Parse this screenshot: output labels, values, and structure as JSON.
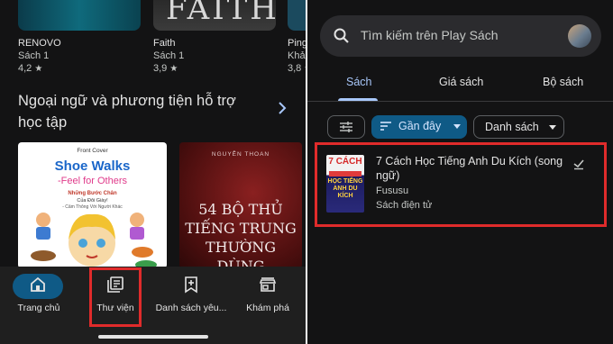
{
  "left": {
    "top_books": [
      {
        "title": "RENOVO",
        "subtitle": "Sách 1",
        "rating": "4,2"
      },
      {
        "title": "Faith",
        "subtitle": "Sách 1",
        "rating": "3,9",
        "cover_text": "FAITH"
      },
      {
        "title": "Ping",
        "subtitle": "Khả",
        "rating": "3,8"
      }
    ],
    "section_title": "Ngoại ngữ và phương tiện hỗ trợ học tập",
    "cover_a": {
      "front": "Front Cover",
      "title": "Shoe Walks",
      "subtitle": "-Feel for Others",
      "vi1": "Những Bước Chân",
      "vi2": "Của Đôi Giày!",
      "vi3": "- Cảm Thông Với Người Khác"
    },
    "cover_b": {
      "author": "NGUYỄN THOAN",
      "title_line1": "54 BỘ THỦ",
      "title_line2": "TIẾNG TRUNG",
      "title_line3": "THƯỜNG DÙNG"
    },
    "nav": {
      "home": "Trang chủ",
      "library": "Thư viện",
      "wishlist": "Danh sách yêu...",
      "explore": "Khám phá"
    },
    "star_glyph": "★"
  },
  "right": {
    "search_placeholder": "Tìm kiếm trên Play Sách",
    "tabs": [
      "Sách",
      "Giá sách",
      "Bộ sách"
    ],
    "chips": {
      "recent": "Gần đây",
      "list": "Danh sách"
    },
    "book": {
      "title": "7 Cách Học Tiếng Anh Du Kích (song ngữ)",
      "author": "Fususu",
      "type": "Sách điện tử",
      "cover_top": "7 CÁCH",
      "cover_mid": "HỌC TIẾNG ANH DU KÍCH"
    }
  },
  "colors": {
    "background": "#131314",
    "accent": "#a8c7fa",
    "chip_active": "#0f5a86",
    "highlight": "#e02b2b"
  },
  "icons": [
    "search-icon",
    "avatar",
    "filter-icon",
    "sort-icon",
    "chevron-down-icon",
    "check-icon",
    "chevron-right-icon",
    "home-icon",
    "library-icon",
    "bookmark-add-icon",
    "store-icon",
    "star-icon"
  ]
}
